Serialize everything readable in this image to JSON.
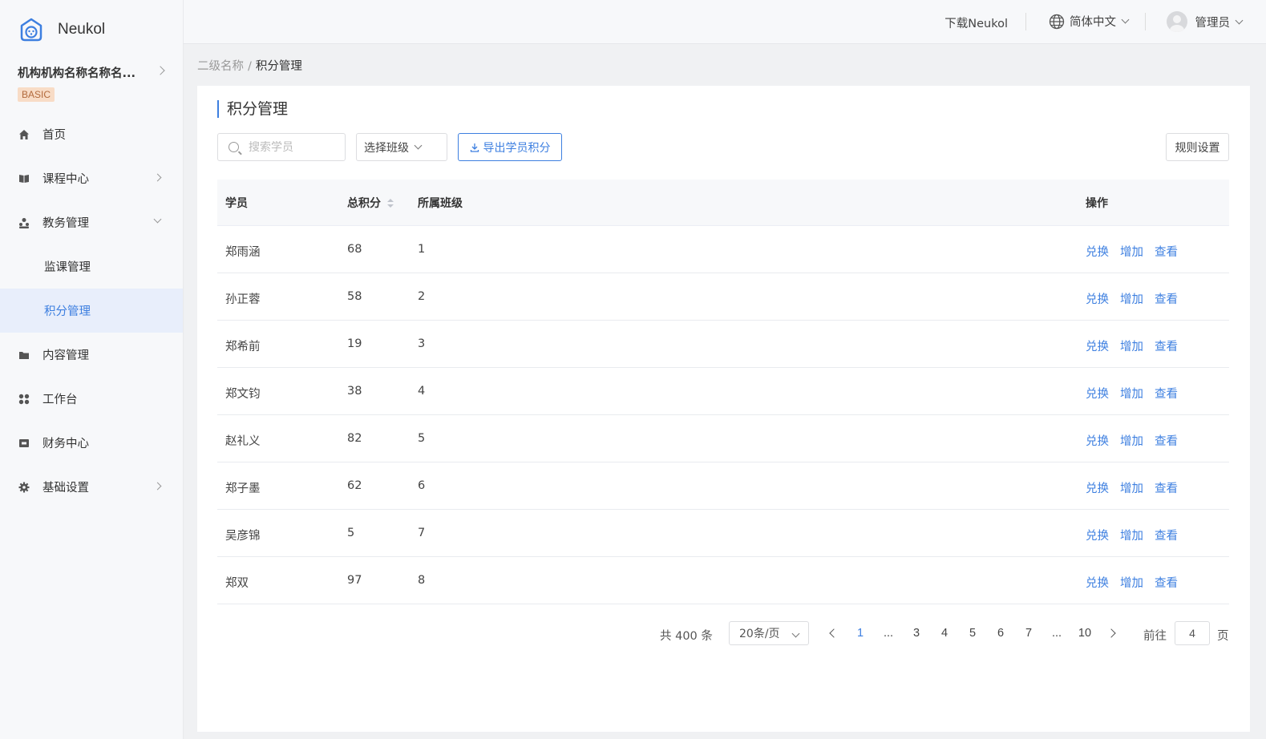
{
  "app": {
    "name": "Neukol"
  },
  "org": {
    "name": "机构机构名称名称名...",
    "plan_badge": "BASIC"
  },
  "sidebar": {
    "items": [
      {
        "label": "首页",
        "icon": "home-icon"
      },
      {
        "label": "课程中心",
        "icon": "book-icon"
      },
      {
        "label": "教务管理",
        "icon": "users-icon"
      },
      {
        "label": "监课管理"
      },
      {
        "label": "积分管理"
      },
      {
        "label": "内容管理",
        "icon": "folder-icon"
      },
      {
        "label": "工作台",
        "icon": "grid-icon"
      },
      {
        "label": "财务中心",
        "icon": "wallet-icon"
      },
      {
        "label": "基础设置",
        "icon": "gear-icon"
      }
    ]
  },
  "header": {
    "download": "下载Neukol",
    "language": "简体中文",
    "user": "管理员"
  },
  "breadcrumb": {
    "parent": "二级名称",
    "separator": "/",
    "current": "积分管理"
  },
  "page": {
    "title": "积分管理",
    "search_placeholder": "搜索学员",
    "class_select": "选择班级",
    "export_label": "导出学员积分",
    "rules_label": "规则设置"
  },
  "table": {
    "columns": [
      "学员",
      "总积分",
      "所属班级",
      "操作"
    ],
    "actions": [
      "兑换",
      "增加",
      "查看"
    ],
    "rows": [
      {
        "name": "郑雨涵",
        "points": "68",
        "class": "1"
      },
      {
        "name": "孙正蓉",
        "points": "58",
        "class": "2"
      },
      {
        "name": "郑希前",
        "points": "19",
        "class": "3"
      },
      {
        "name": "郑文钧",
        "points": "38",
        "class": "4"
      },
      {
        "name": "赵礼义",
        "points": "82",
        "class": "5"
      },
      {
        "name": "郑子墨",
        "points": "62",
        "class": "6"
      },
      {
        "name": "吴彦锦",
        "points": "5",
        "class": "7"
      },
      {
        "name": "郑双",
        "points": "97",
        "class": "8"
      }
    ]
  },
  "pagination": {
    "total": "共 400 条",
    "page_size": "20条/页",
    "pages": [
      "1",
      "...",
      "3",
      "4",
      "5",
      "6",
      "7",
      "...",
      "10"
    ],
    "current": "1",
    "goto_label": "前往",
    "goto_value": "4",
    "page_suffix": "页"
  },
  "colors": {
    "accent": "#3d7fe0",
    "badge_bg": "#f8dcc6",
    "badge_text": "#b26a3c",
    "active_bg": "#e8eefb"
  }
}
